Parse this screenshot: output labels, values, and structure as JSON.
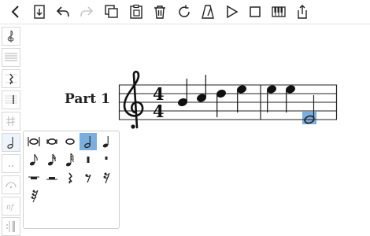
{
  "toolbar": {
    "buttons": [
      {
        "name": "back-icon",
        "icon": "chevron-left"
      },
      {
        "name": "import-icon",
        "icon": "tray-down"
      },
      {
        "name": "undo-icon",
        "icon": "undo"
      },
      {
        "name": "redo-icon",
        "icon": "redo",
        "enabled": false
      },
      {
        "name": "copy-icon",
        "icon": "copy"
      },
      {
        "name": "paste-icon",
        "icon": "paste"
      },
      {
        "name": "trash-icon",
        "icon": "trash"
      },
      {
        "name": "refresh-icon",
        "icon": "rotate"
      },
      {
        "name": "metronome-icon",
        "icon": "metronome"
      },
      {
        "name": "play-icon",
        "icon": "play"
      },
      {
        "name": "stop-icon",
        "icon": "stop"
      },
      {
        "name": "piano-keyboard-icon",
        "icon": "keyboard"
      },
      {
        "name": "share-icon",
        "icon": "share"
      }
    ]
  },
  "palette": {
    "items": [
      "treble-clef-icon",
      "staff-lines-icon",
      "quarter-rest-icon",
      "barline-icon",
      "accidental-icon",
      "half-note-icon",
      "dynamics-dots-icon",
      "ornament-icon",
      "dynamic-nf-icon",
      "repeat-barline-icon"
    ],
    "selected": "half-note-icon"
  },
  "durations": {
    "items": [
      "breve-with-stems",
      "breve",
      "whole",
      "half",
      "quarter",
      "eighth",
      "sixteenth",
      "thirty-second",
      "half-rest-bar",
      "quarter-rest-bar",
      "whole-rest",
      "half-rest",
      "quarter-rest",
      "eighth-rest",
      "sixteenth-rest",
      "thirty-second-rest"
    ],
    "selected": "half"
  },
  "score": {
    "part_label": "Part 1",
    "time_signature_top": "4",
    "time_signature_bottom": "4"
  },
  "colors": {
    "selection": "#7aaede",
    "toolbar_disabled": "#c8c8c8"
  }
}
